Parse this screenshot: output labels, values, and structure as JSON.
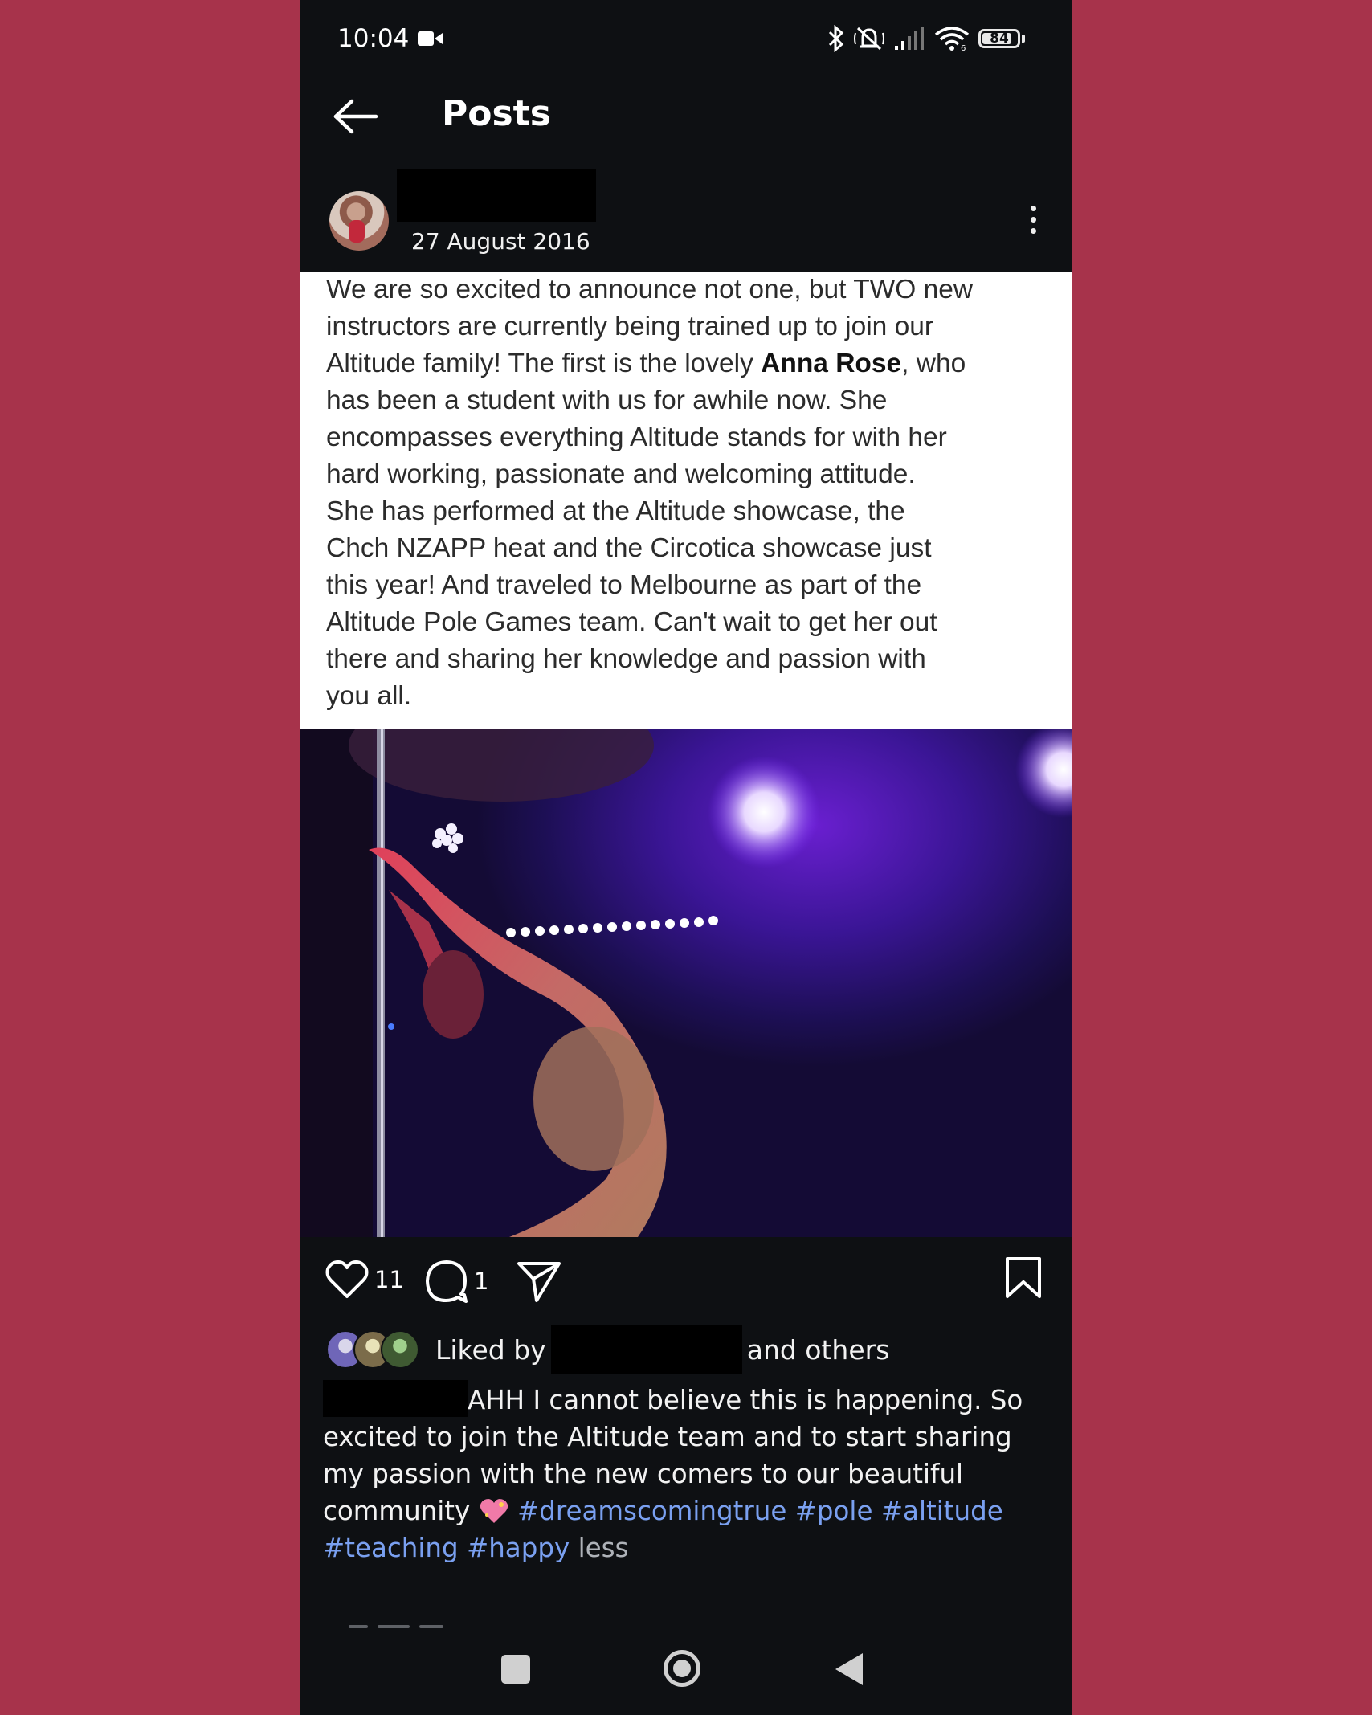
{
  "status_bar": {
    "time": "10:04",
    "battery": "84",
    "icons": [
      "video-record-icon",
      "bluetooth-icon",
      "mute-icon",
      "signal-icon",
      "wifi-icon",
      "battery-icon"
    ]
  },
  "header": {
    "title": "Posts"
  },
  "post": {
    "date": "27 August 2016",
    "card_text_before": "We are so excited to announce not one, but TWO new\ninstructors are currently being trained up to join our\nAltitude family! The first is the lovely ",
    "card_text_bold": "Anna Rose",
    "card_text_after": ", who\nhas been a student with us for awhile now. She\nencompasses everything Altitude stands for with her\nhard working, passionate and welcoming attitude.\nShe has performed at the Altitude showcase, the\nChch NZAPP heat and the Circotica showcase just\nthis year! And traveled to Melbourne as part of the\nAltitude Pole Games team. Can't wait to get her out\nthere and sharing her knowledge and passion with\nyou all.",
    "likes_count": "11",
    "comments_count": "1",
    "liked_by_prefix": "Liked by",
    "liked_by_suffix": "and others",
    "caption_text": "AHH I cannot believe this is happening. So excited to join the Altitude team and to start sharing my passion with the new comers to our beautiful community ",
    "hashtags": [
      "#dreamscomingtrue",
      "#pole",
      "#altitude",
      "#teaching",
      "#happy"
    ],
    "less_label": "less"
  },
  "colors": {
    "page_bg": "#a7334b",
    "app_bg": "#0e1013",
    "hashtag": "#7aa0f0"
  }
}
